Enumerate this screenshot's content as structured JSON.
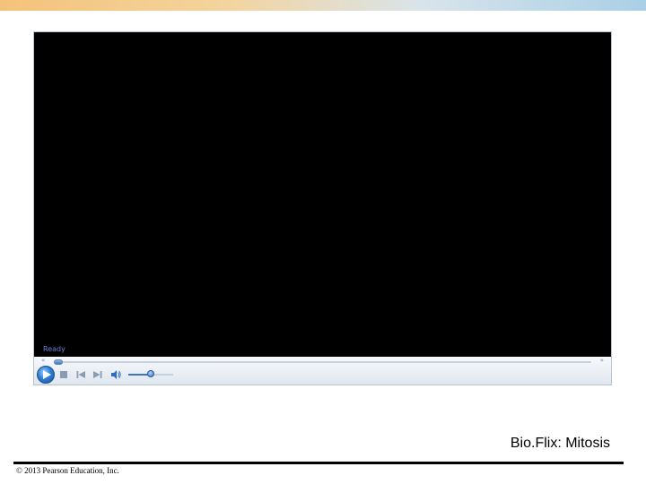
{
  "colors": {
    "video_background": "#000000",
    "status_text": "#6f7fd6",
    "accent": "#2f7fd6",
    "top_band_left": "#f5c27a",
    "top_band_right": "#a9cfe6"
  },
  "player": {
    "status": "Ready",
    "seek": {
      "rewind_icon": "double-left-arrow",
      "forward_icon": "double-right-arrow",
      "rewind_label": "«",
      "forward_label": "»",
      "position_fraction": 0
    },
    "controls": {
      "play_icon": "play-icon",
      "stop_icon": "stop-icon",
      "previous_icon": "skip-previous-icon",
      "next_icon": "skip-next-icon",
      "mute_icon": "speaker-icon"
    },
    "volume_fraction": 0.5
  },
  "slide": {
    "title": "Bio.Flix: Mitosis",
    "copyright": "© 2013 Pearson Education, Inc."
  }
}
